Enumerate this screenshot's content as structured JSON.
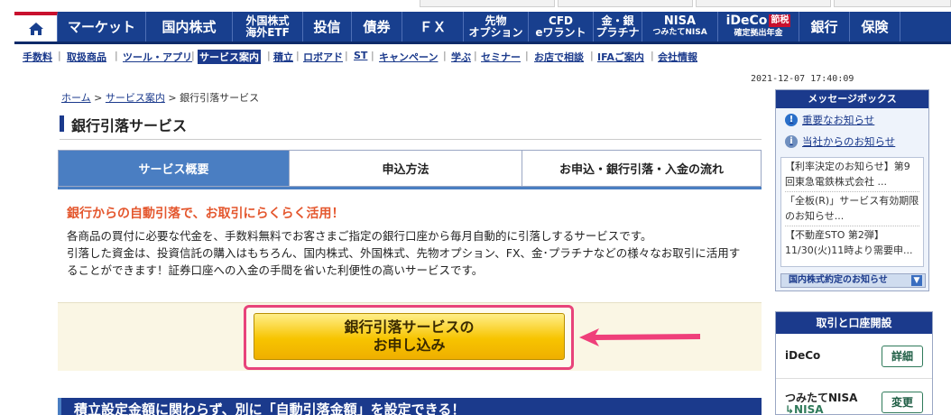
{
  "top_nav": {
    "items": [
      {
        "label": "マーケット"
      },
      {
        "label": "国内株式"
      },
      {
        "line1": "外国株式",
        "line2": "海外ETF"
      },
      {
        "label": "投信"
      },
      {
        "label": "債券"
      },
      {
        "label": "ＦＸ"
      },
      {
        "line1": "先物",
        "line2": "オプション"
      },
      {
        "line1": "CFD",
        "line2": "eワラント"
      },
      {
        "line1": "金・銀",
        "line2": "プラチナ"
      },
      {
        "line1": "NISA",
        "line2": "つみたてNISA"
      },
      {
        "line1": "iDeCo",
        "badge": "節税",
        "line2": "確定拠出年金"
      },
      {
        "label": "銀行"
      },
      {
        "label": "保険"
      }
    ]
  },
  "sub_nav": {
    "items": [
      "手数料",
      "取扱商品",
      "ツール・アプリ",
      "サービス案内",
      "積立",
      "ロボアド",
      "ST",
      "キャンペーン",
      "学ぶ",
      "セミナー",
      "お店で相談",
      "IFAご案内",
      "会社情報"
    ],
    "active": "サービス案内"
  },
  "timestamp": "2021-12-07 17:40:09",
  "breadcrumb": {
    "home": "ホーム",
    "sep": ">",
    "section": "サービス案内",
    "current": "銀行引落サービス"
  },
  "page_title": "銀行引落サービス",
  "tabs": [
    "サービス概要",
    "申込方法",
    "お申込・銀行引落・入金の流れ"
  ],
  "lead": "銀行からの自動引落で、お取引にらくらく活用！",
  "body": [
    "各商品の買付に必要な代金を、手数料無料でお客さまご指定の銀行口座から毎月自動的に引落しするサービスです。",
    "引落した資金は、投資信託の購入はもちろん、国内株式、外国株式、先物オプション、FX、金･プラチナなどの様々なお取引に活用す",
    "ることができます！証券口座への入金の手間を省いた利便性の高いサービスです。"
  ],
  "cta": {
    "line1": "銀行引落サービスの",
    "line2": "お申し込み"
  },
  "next_section_title": "積立設定金額に関わらず、別に「自動引落金額」を設定できる！",
  "message_box": {
    "title": "メッセージボックス",
    "link1": "重要なお知らせ",
    "link2": "当社からのお知らせ",
    "notices": [
      "【利率決定のお知らせ】第9回東急電鉄株式会社 ...",
      "「全板(R)」サービス有効期限のお知らせ...",
      "【不動産STO 第2弾】11/30(火)11時より需要申..."
    ],
    "footer": "国内株式約定のお知らせ"
  },
  "account_panel": {
    "title": "取引と口座開設",
    "rows": [
      {
        "label": "iDeCo",
        "button": "詳細"
      },
      {
        "label": "つみたてNISA",
        "label2": "↳NISA",
        "button": "変更"
      }
    ]
  },
  "colors": {
    "nav": "#183f8e",
    "accent_red": "#c8102e",
    "lead": "#e4572e",
    "cta_gold": "#f7c400",
    "highlight_pink": "#e8437a"
  }
}
